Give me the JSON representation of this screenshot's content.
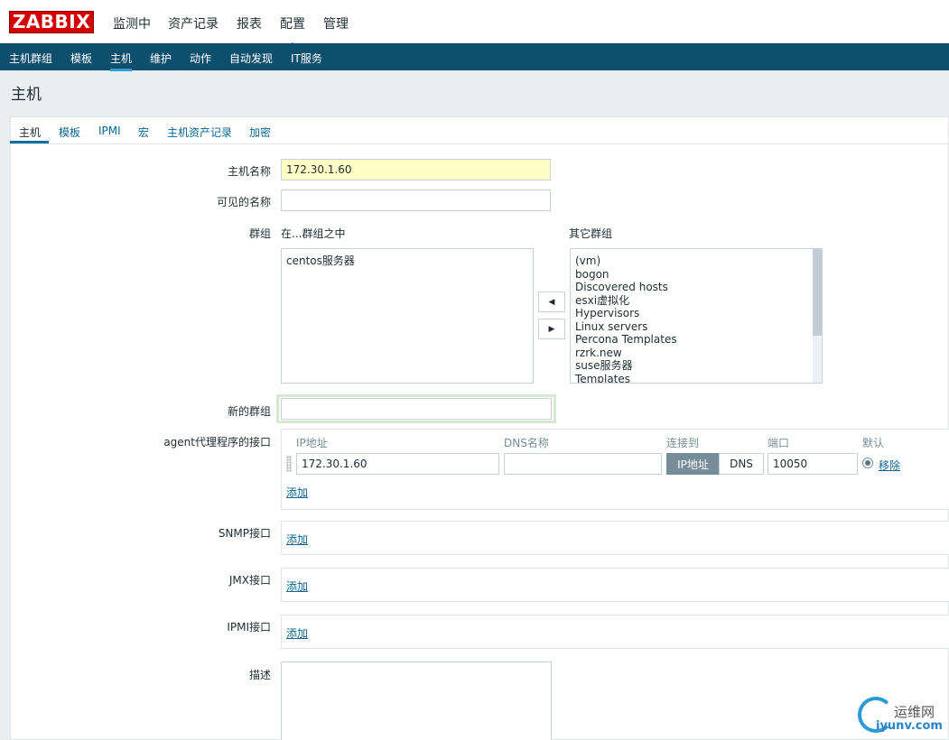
{
  "app": {
    "logo": "ZABBIX"
  },
  "top_menu": [
    "监测中",
    "资产记录",
    "报表",
    "配置",
    "管理"
  ],
  "sub_nav": [
    "主机群组",
    "模板",
    "主机",
    "维护",
    "动作",
    "自动发现",
    "IT服务"
  ],
  "page_title": "主机",
  "tabs": [
    "主机",
    "模板",
    "IPMI",
    "宏",
    "主机资产记录",
    "加密"
  ],
  "form": {
    "host_name_label": "主机名称",
    "host_name_value": "172.30.1.60",
    "visible_name_label": "可见的名称",
    "visible_name_value": "",
    "groups_label": "群组",
    "in_groups_label": "在...群组之中",
    "other_groups_label": "其它群组",
    "in_groups": [
      "centos服务器"
    ],
    "other_groups": [
      "(vm)",
      "bogon",
      "Discovered hosts",
      "esxi虚拟化",
      "Hypervisors",
      "Linux servers",
      "Percona Templates",
      "rzrk.new",
      "suse服务器",
      "Templates"
    ],
    "new_group_label": "新的群组",
    "new_group_value": "",
    "agent_label": "agent代理程序的接口",
    "col_ip": "IP地址",
    "col_dns": "DNS名称",
    "col_connect": "连接到",
    "col_port": "端口",
    "col_default": "默认",
    "agent_ip": "172.30.1.60",
    "agent_dns": "",
    "connect_ip": "IP地址",
    "connect_dns": "DNS",
    "agent_port": "10050",
    "remove_link": "移除",
    "add_link": "添加",
    "snmp_label": "SNMP接口",
    "jmx_label": "JMX接口",
    "ipmi_label": "IPMI接口",
    "description_label": "描述"
  },
  "watermark": {
    "cn": "运维网",
    "en": "iyunv.com"
  }
}
